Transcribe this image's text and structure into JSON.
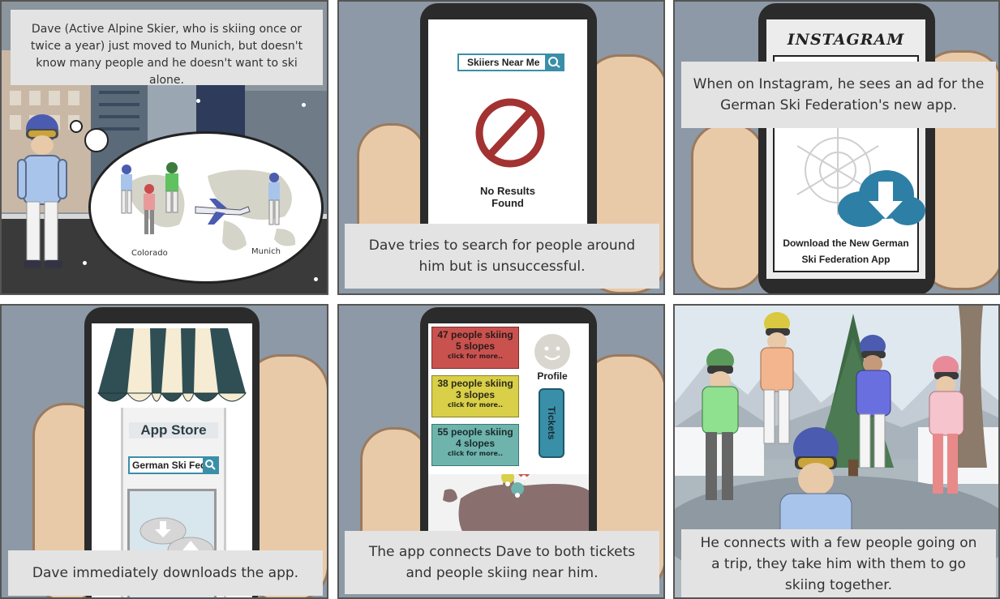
{
  "panels": [
    {
      "caption": "Dave (Active Alpine Skier, who is skiing once or twice a year) just moved to Munich, but doesn't know many people and he doesn't want to ski alone.",
      "map_labels": {
        "left": "Colorado",
        "right": "Munich"
      }
    },
    {
      "caption": "Dave tries to search for people around him but is unsuccessful.",
      "search_label": "Skiiers Near Me",
      "result_text_line1": "No Results",
      "result_text_line2": "Found"
    },
    {
      "caption": "When on Instagram, he sees an ad for the German Ski Federation's new app.",
      "app_title": "INSTAGRAM",
      "ad_text_line1": "Download the New German",
      "ad_text_line2": "Ski Federation App"
    },
    {
      "caption": "Dave immediately downloads the app.",
      "store_sign": "App Store",
      "search_value": "German Ski Fed"
    },
    {
      "caption": "The app connects Dave to both tickets and people skiing near him.",
      "cards": [
        {
          "line1": "47 people skiing",
          "line2": "5 slopes",
          "line3": "click for more..",
          "color": "#c9524e"
        },
        {
          "line1": "38 people skiing",
          "line2": "3 slopes",
          "line3": "click for more..",
          "color": "#d9cf48"
        },
        {
          "line1": "55 people skiing",
          "line2": "4 slopes",
          "line3": "click for more..",
          "color": "#6fb3ad"
        }
      ],
      "profile_label": "Profile",
      "tickets_label": "Tickets"
    },
    {
      "caption": "He connects with a few people going on a trip, they take him with them to go skiing together."
    }
  ],
  "colors": {
    "panel_bg": "#8d99a6",
    "caption_bg": "#e3e3e3",
    "skin": "#e8c9a8",
    "search_bar": "#3a8fa8"
  }
}
